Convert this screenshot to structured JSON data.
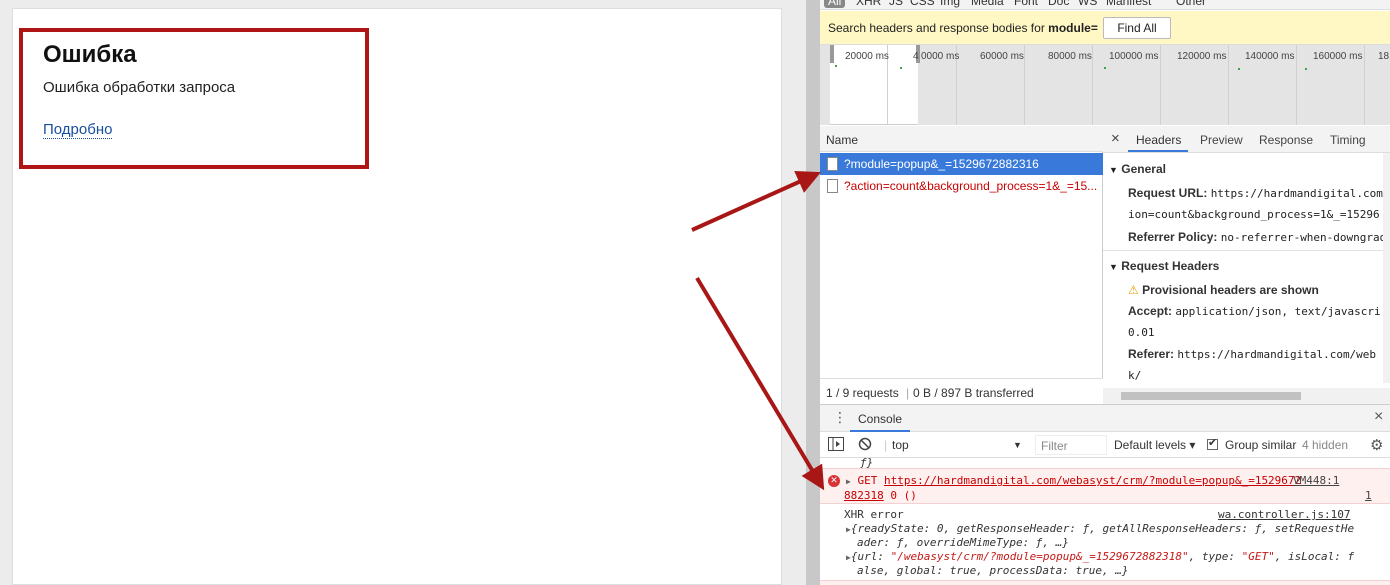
{
  "page": {
    "error_title": "Ошибка",
    "error_message": "Ошибка обработки запроса",
    "details_link": "Подробно"
  },
  "devtools": {
    "filter_types": [
      "All",
      "XHR",
      "JS",
      "CSS",
      "Img",
      "Media",
      "Font",
      "Doc",
      "WS",
      "Manifest",
      "Other"
    ],
    "search": {
      "label_prefix": "Search headers and response bodies for",
      "query": "module=",
      "find_all": "Find All"
    },
    "timeline_ticks": [
      "20000 ms",
      "4",
      "0000 ms",
      "60000 ms",
      "80000 ms",
      "100000 ms",
      "120000 ms",
      "140000 ms",
      "160000 ms",
      "18"
    ],
    "list": {
      "header": "Name",
      "rows": [
        "?module=popup&_=1529672882316",
        "?action=count&background_process=1&_=15..."
      ],
      "footer_requests": "1 / 9 requests",
      "footer_transferred": "0 B / 897 B transferred"
    },
    "detail_tabs": [
      "Headers",
      "Preview",
      "Response",
      "Timing"
    ],
    "close_glyph": "×",
    "general": {
      "title": "General",
      "request_url_key": "Request URL:",
      "request_url_val": "https://hardmandigital.com",
      "request_url_cont": "ion=count&background_process=1&_=15296",
      "referrer_policy_key": "Referrer Policy:",
      "referrer_policy_val": "no-referrer-when-downgrad"
    },
    "request_headers": {
      "title": "Request Headers",
      "warning": "Provisional headers are shown",
      "accept_key": "Accept:",
      "accept_val": "application/json, text/javascri",
      "accept_cont": "0.01",
      "referer_key": "Referer:",
      "referer_val": "https://hardmandigital.com/web",
      "referer_cont": "k/"
    },
    "console": {
      "tab": "Console",
      "context": "top",
      "filter_placeholder": "Filter",
      "levels": "Default levels ▾",
      "group_similar": "Group similar",
      "hidden": "4 hidden",
      "prev_line": "ƒ}",
      "error1_method": "GET",
      "error1_url": "https://hardmandigital.com/webasyst/crm/?module=popup&_=1529672",
      "error1_url_cont": "882318",
      "error1_status": "0 ()",
      "error1_source": "VM448:1",
      "xhr_error": "XHR error",
      "xhr_source": "wa.controller.js:107",
      "obj1_line1": "{readyState: 0, getResponseHeader: ƒ, getAllResponseHeaders: ƒ, setRequestHe",
      "obj1_line2": "ader: ƒ, overrideMimeType: ƒ, …}",
      "obj2_line1_a": "{url: ",
      "obj2_line1_url": "\"/webasyst/crm/?module=popup&_=1529672882318\"",
      "obj2_line1_b": ", type: ",
      "obj2_line1_type": "\"GET\"",
      "obj2_line1_c": ", isLocal: f",
      "obj2_line2": "alse, global: true, processData: true, …}"
    }
  }
}
